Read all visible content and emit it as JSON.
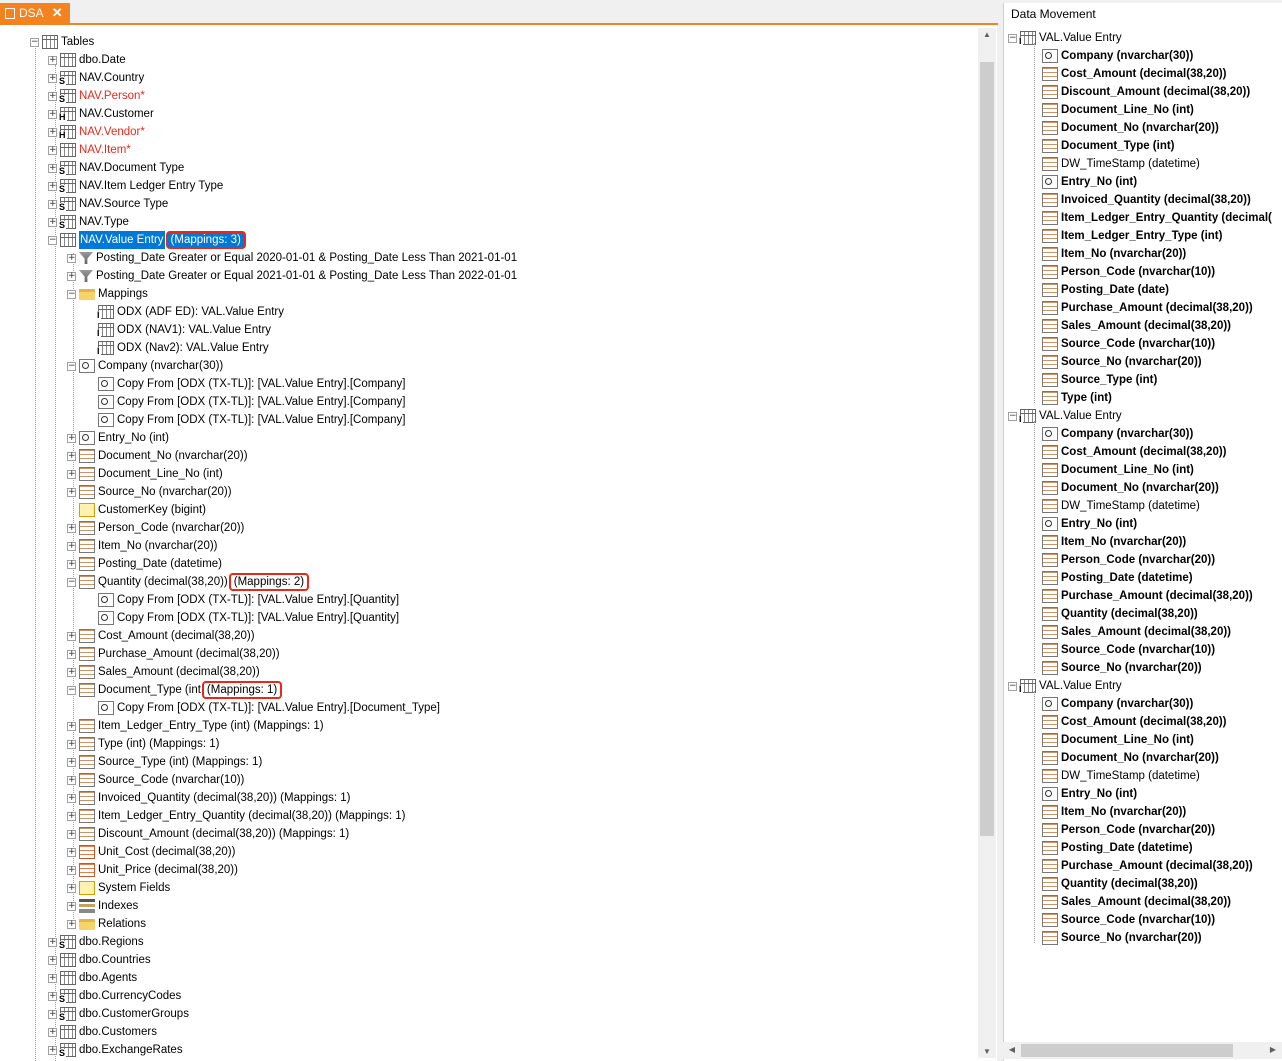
{
  "tab": {
    "label": "DSA",
    "close": "✕"
  },
  "left_tree": {
    "root": "Tables",
    "nodes": [
      {
        "label": "dbo.Date",
        "icon": "date-table-icon"
      },
      {
        "label": "NAV.Country",
        "icon": "s-table-icon"
      },
      {
        "label": "NAV.Person*",
        "icon": "s-table-icon",
        "red": true
      },
      {
        "label": "NAV.Customer",
        "icon": "h-table-icon"
      },
      {
        "label": "NAV.Vendor*",
        "icon": "h-table-icon",
        "red": true
      },
      {
        "label": "NAV.Item*",
        "icon": "table-icon",
        "red": true
      },
      {
        "label": "NAV.Document Type",
        "icon": "s-table-icon"
      },
      {
        "label": "NAV.Item Ledger Entry Type",
        "icon": "s-table-icon"
      },
      {
        "label": "NAV.Source Type",
        "icon": "s-table-icon"
      },
      {
        "label": "NAV.Type",
        "icon": "s-table-icon"
      },
      {
        "label": "NAV.Value Entry",
        "icon": "table-icon",
        "selected": true,
        "mappings": "(Mappings: 3)"
      }
    ],
    "value_entry_children": [
      {
        "label": "Posting_Date Greater or Equal 2020-01-01 & Posting_Date Less Than 2021-01-01",
        "icon": "filter-icon"
      },
      {
        "label": "Posting_Date Greater or Equal 2021-01-01 & Posting_Date Less Than 2022-01-01",
        "icon": "filter-icon"
      },
      {
        "label": "Mappings",
        "icon": "folder-icon"
      },
      {
        "label": "ODX (ADF ED): VAL.Value Entry",
        "icon": "i-table-icon",
        "level": 3
      },
      {
        "label": "ODX (NAV1): VAL.Value Entry",
        "icon": "i-table-icon",
        "level": 3
      },
      {
        "label": "ODX (Nav2): VAL.Value Entry",
        "icon": "i-table-icon",
        "level": 3
      },
      {
        "label": "Company (nvarchar(30))",
        "icon": "key-column-icon"
      },
      {
        "label": "Copy From [ODX (TX-TL)]: [VAL.Value Entry].[Company]",
        "icon": "copy-icon",
        "level": 3
      },
      {
        "label": "Copy From [ODX (TX-TL)]: [VAL.Value Entry].[Company]",
        "icon": "copy-icon",
        "level": 3
      },
      {
        "label": "Copy From [ODX (TX-TL)]: [VAL.Value Entry].[Company]",
        "icon": "copy-icon",
        "level": 3
      },
      {
        "label": "Entry_No (int)",
        "icon": "key-column-icon"
      },
      {
        "label": "Document_No (nvarchar(20))",
        "icon": "column-icon"
      },
      {
        "label": "Document_Line_No (int)",
        "icon": "column-icon"
      },
      {
        "label": "Source_No (nvarchar(20))",
        "icon": "column-icon"
      },
      {
        "label": "CustomerKey (bigint)",
        "icon": "lookup-column-icon"
      },
      {
        "label": "Person_Code (nvarchar(20))",
        "icon": "column-icon"
      },
      {
        "label": "Item_No (nvarchar(20))",
        "icon": "column-icon"
      },
      {
        "label": "Posting_Date (datetime)",
        "icon": "column-icon"
      },
      {
        "label": "Quantity (decimal(38,20))",
        "icon": "column-icon",
        "mappings": "(Mappings: 2)"
      },
      {
        "label": "Copy From [ODX (TX-TL)]: [VAL.Value Entry].[Quantity]",
        "icon": "copy-icon",
        "level": 3
      },
      {
        "label": "Copy From [ODX (TX-TL)]: [VAL.Value Entry].[Quantity]",
        "icon": "copy-icon",
        "level": 3
      },
      {
        "label": "Cost_Amount (decimal(38,20))",
        "icon": "column-icon"
      },
      {
        "label": "Purchase_Amount (decimal(38,20))",
        "icon": "column-icon"
      },
      {
        "label": "Sales_Amount (decimal(38,20))",
        "icon": "column-icon"
      },
      {
        "label": "Document_Type (int",
        "icon": "column-icon",
        "mappings": "(Mappings: 1)"
      },
      {
        "label": "Copy From [ODX (TX-TL)]: [VAL.Value Entry].[Document_Type]",
        "icon": "copy-icon",
        "level": 3
      },
      {
        "label": "Item_Ledger_Entry_Type (int) (Mappings: 1)",
        "icon": "column-icon"
      },
      {
        "label": "Type (int) (Mappings: 1)",
        "icon": "column-icon"
      },
      {
        "label": "Source_Type (int) (Mappings: 1)",
        "icon": "column-icon"
      },
      {
        "label": "Source_Code (nvarchar(10))",
        "icon": "column-icon"
      },
      {
        "label": "Invoiced_Quantity (decimal(38,20)) (Mappings: 1)",
        "icon": "column-icon"
      },
      {
        "label": "Item_Ledger_Entry_Quantity (decimal(38,20)) (Mappings: 1)",
        "icon": "column-icon"
      },
      {
        "label": "Discount_Amount (decimal(38,20)) (Mappings: 1)",
        "icon": "column-icon"
      },
      {
        "label": "Unit_Cost (decimal(38,20))",
        "icon": "orange-column-icon"
      },
      {
        "label": "Unit_Price (decimal(38,20))",
        "icon": "orange-column-icon"
      },
      {
        "label": "System Fields",
        "icon": "system-fields-icon"
      },
      {
        "label": "Indexes",
        "icon": "index-icon"
      },
      {
        "label": "Relations",
        "icon": "folder-icon"
      }
    ],
    "after": [
      {
        "label": "dbo.Regions",
        "icon": "s-table-icon"
      },
      {
        "label": "dbo.Countries",
        "icon": "table-icon"
      },
      {
        "label": "dbo.Agents",
        "icon": "table-icon"
      },
      {
        "label": "dbo.CurrencyCodes",
        "icon": "s-table-icon"
      },
      {
        "label": "dbo.CustomerGroups",
        "icon": "s-table-icon"
      },
      {
        "label": "dbo.Customers",
        "icon": "table-icon"
      },
      {
        "label": "dbo.ExchangeRates",
        "icon": "s-table-icon"
      }
    ]
  },
  "data_movement": {
    "title": "Data Movement",
    "groups": [
      {
        "label": "VAL.Value Entry",
        "fields": [
          {
            "label": "Company (nvarchar(30))",
            "bold": true,
            "key": true
          },
          {
            "label": "Cost_Amount (decimal(38,20))",
            "bold": true
          },
          {
            "label": "Discount_Amount (decimal(38,20))",
            "bold": true
          },
          {
            "label": "Document_Line_No (int)",
            "bold": true
          },
          {
            "label": "Document_No (nvarchar(20))",
            "bold": true
          },
          {
            "label": "Document_Type (int)",
            "bold": true
          },
          {
            "label": "DW_TimeStamp (datetime)",
            "bold": false
          },
          {
            "label": "Entry_No (int)",
            "bold": true,
            "key": true
          },
          {
            "label": "Invoiced_Quantity (decimal(38,20))",
            "bold": true
          },
          {
            "label": "Item_Ledger_Entry_Quantity (decimal(",
            "bold": true
          },
          {
            "label": "Item_Ledger_Entry_Type (int)",
            "bold": true
          },
          {
            "label": "Item_No (nvarchar(20))",
            "bold": true
          },
          {
            "label": "Person_Code (nvarchar(10))",
            "bold": true
          },
          {
            "label": "Posting_Date (date)",
            "bold": true
          },
          {
            "label": "Purchase_Amount (decimal(38,20))",
            "bold": true
          },
          {
            "label": "Sales_Amount (decimal(38,20))",
            "bold": true
          },
          {
            "label": "Source_Code (nvarchar(10))",
            "bold": true
          },
          {
            "label": "Source_No (nvarchar(20))",
            "bold": true
          },
          {
            "label": "Source_Type (int)",
            "bold": true
          },
          {
            "label": "Type (int)",
            "bold": true
          }
        ]
      },
      {
        "label": "VAL.Value Entry",
        "fields": [
          {
            "label": "Company (nvarchar(30))",
            "bold": true,
            "key": true
          },
          {
            "label": "Cost_Amount (decimal(38,20))",
            "bold": true
          },
          {
            "label": "Document_Line_No (int)",
            "bold": true
          },
          {
            "label": "Document_No (nvarchar(20))",
            "bold": true
          },
          {
            "label": "DW_TimeStamp (datetime)",
            "bold": false
          },
          {
            "label": "Entry_No (int)",
            "bold": true,
            "key": true
          },
          {
            "label": "Item_No (nvarchar(20))",
            "bold": true
          },
          {
            "label": "Person_Code (nvarchar(20))",
            "bold": true
          },
          {
            "label": "Posting_Date (datetime)",
            "bold": true
          },
          {
            "label": "Purchase_Amount (decimal(38,20))",
            "bold": true
          },
          {
            "label": "Quantity (decimal(38,20))",
            "bold": true
          },
          {
            "label": "Sales_Amount (decimal(38,20))",
            "bold": true
          },
          {
            "label": "Source_Code (nvarchar(10))",
            "bold": true
          },
          {
            "label": "Source_No (nvarchar(20))",
            "bold": true
          }
        ]
      },
      {
        "label": "VAL.Value Entry",
        "fields": [
          {
            "label": "Company (nvarchar(30))",
            "bold": true,
            "key": true
          },
          {
            "label": "Cost_Amount (decimal(38,20))",
            "bold": true
          },
          {
            "label": "Document_Line_No (int)",
            "bold": true
          },
          {
            "label": "Document_No (nvarchar(20))",
            "bold": true
          },
          {
            "label": "DW_TimeStamp (datetime)",
            "bold": false
          },
          {
            "label": "Entry_No (int)",
            "bold": true,
            "key": true
          },
          {
            "label": "Item_No (nvarchar(20))",
            "bold": true
          },
          {
            "label": "Person_Code (nvarchar(20))",
            "bold": true
          },
          {
            "label": "Posting_Date (datetime)",
            "bold": true
          },
          {
            "label": "Purchase_Amount (decimal(38,20))",
            "bold": true
          },
          {
            "label": "Quantity (decimal(38,20))",
            "bold": true
          },
          {
            "label": "Sales_Amount (decimal(38,20))",
            "bold": true
          },
          {
            "label": "Source_Code (nvarchar(10))",
            "bold": true
          },
          {
            "label": "Source_No (nvarchar(20))",
            "bold": true
          }
        ]
      }
    ]
  },
  "colors": {
    "accent": "#f3821f",
    "selection": "#0078d7",
    "highlight_red": "#e8281a",
    "error_text": "#e8281a"
  }
}
